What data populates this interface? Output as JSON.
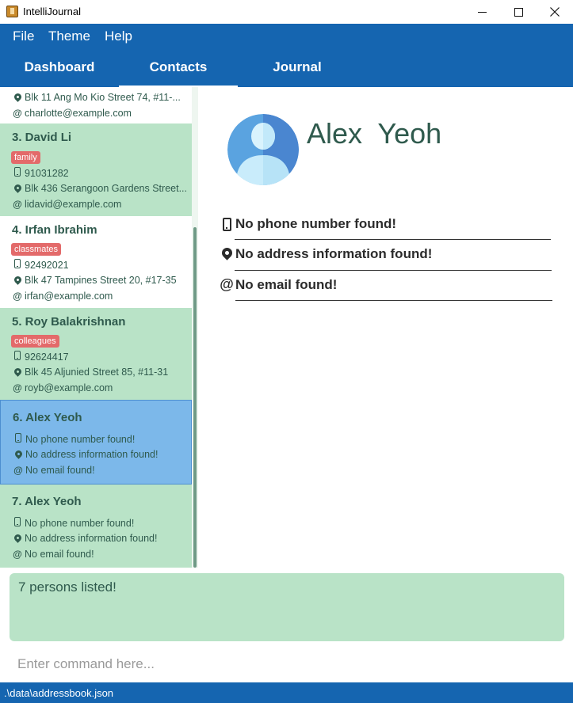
{
  "window": {
    "title": "IntelliJournal"
  },
  "menu": {
    "items": [
      "File",
      "Theme",
      "Help"
    ]
  },
  "tabs": [
    {
      "label": "Dashboard",
      "active": false
    },
    {
      "label": "Contacts",
      "active": true
    },
    {
      "label": "Journal",
      "active": false
    }
  ],
  "contacts": [
    {
      "address": "Blk 11 Ang Mo Kio Street 74, #11-...",
      "email": "charlotte@example.com"
    },
    {
      "title": "3.  David Li",
      "tag": "family",
      "phone": "91031282",
      "address": "Blk 436 Serangoon Gardens Street...",
      "email": "lidavid@example.com"
    },
    {
      "title": "4.  Irfan Ibrahim",
      "tag": "classmates",
      "phone": "92492021",
      "address": "Blk 47 Tampines Street 20, #17-35",
      "email": "irfan@example.com"
    },
    {
      "title": "5.  Roy Balakrishnan",
      "tag": "colleagues",
      "phone": "92624417",
      "address": "Blk 45 Aljunied Street 85, #11-31",
      "email": "royb@example.com"
    },
    {
      "title": "6.  Alex  Yeoh",
      "phone": "No phone number found!",
      "address": "No address information found!",
      "email": "No email found!",
      "selected": true
    },
    {
      "title": "7.  Alex Yeoh",
      "phone": "No phone number found!",
      "address": "No address information found!",
      "email": "No email found!"
    }
  ],
  "detail": {
    "name": "Alex  Yeoh",
    "phone": "No phone number found!",
    "address": "No address information found!",
    "email": "No email found!"
  },
  "result": {
    "text": "7 persons listed!"
  },
  "command": {
    "placeholder": "Enter command here..."
  },
  "status": {
    "path": ".\\data\\addressbook.json"
  },
  "colors": {
    "primary": "#1565b0",
    "card_green": "#b9e3c7",
    "card_selected": "#7cb8ea",
    "tag_red": "#e36a6a",
    "text_dark_green": "#2f5a4d"
  },
  "icons": {
    "phone": "phone-icon",
    "address": "map-marker-icon",
    "email": "at-icon",
    "avatar": "user-avatar-icon"
  }
}
